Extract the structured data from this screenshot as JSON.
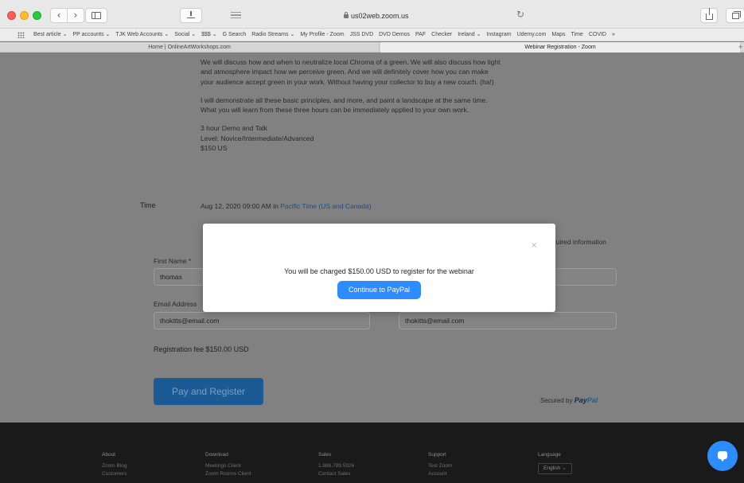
{
  "browser": {
    "address": "us02web.zoom.us",
    "bookmarks": [
      "Best article ⌄",
      "PP accounts ⌄",
      "TJK Web Accounts ⌄",
      "Social ⌄",
      "$$$ ⌄",
      "G Search",
      "Radio Streams ⌄",
      "My Profile - Zoom",
      "JSS DVD",
      "DVD Demos",
      "PAF",
      "Checker",
      "Ireland ⌄",
      "Instagram",
      "Udemy.com",
      "Maps",
      "Time",
      "COVID",
      "»"
    ],
    "tabs": [
      "Home | OnlineArtWorkshops.com",
      "Webinar Registration - Zoom"
    ]
  },
  "description": {
    "paragraph1": "We will discuss how and when to neutralize local Chroma of a green. We will also discuss how light and atmosphere impact how we perceive green. And we will definitely cover how you can make your audience accept green in your work. Without having your collector to buy a new couch. (ha!)",
    "paragraph2": "I will demonstrate all these basic principles, and more, and paint a landscape at the same time. What you will learn from these three hours can be immediately applied to your own work.",
    "detail_line1": "3 hour Demo and Talk",
    "detail_line2": "Level: Novice/Intermediate/Advanced",
    "detail_line3": "$150 US"
  },
  "time": {
    "label": "Time",
    "value": "Aug 12, 2020 09:00 AM in",
    "timezone": "Pacific Time (US and Canada)"
  },
  "form": {
    "required_info": "quired information",
    "first_name_label": "First Name *",
    "first_name_value": "thomas",
    "email_label": "Email Address",
    "email_value": "thokitts@email.com",
    "confirm_email_value": "thokitts@email.com",
    "registration_fee": "Registration fee $150.00 USD",
    "pay_button": "Pay and Register",
    "secured_by": "Secured by",
    "paypal_part1": "Pay",
    "paypal_part2": "Pal"
  },
  "footer": {
    "about": {
      "heading": "About",
      "items": [
        "Zoom Blog",
        "Customers"
      ]
    },
    "download": {
      "heading": "Download",
      "items": [
        "Meetings Client",
        "Zoom Rooms Client"
      ]
    },
    "sales": {
      "heading": "Sales",
      "items": [
        "1.888.799.5926",
        "Contact Sales"
      ]
    },
    "support": {
      "heading": "Support",
      "items": [
        "Test Zoom",
        "Account"
      ]
    },
    "language": {
      "heading": "Language",
      "selected": "English ⌄"
    }
  },
  "modal": {
    "close": "×",
    "message": "You will be charged $150.00 USD to register for the webinar",
    "button": "Continue to PayPal"
  },
  "colors": {
    "zoom_blue": "#2d8cff",
    "overlay_gray": "#808080",
    "footer_dark": "#1a1a1a"
  }
}
